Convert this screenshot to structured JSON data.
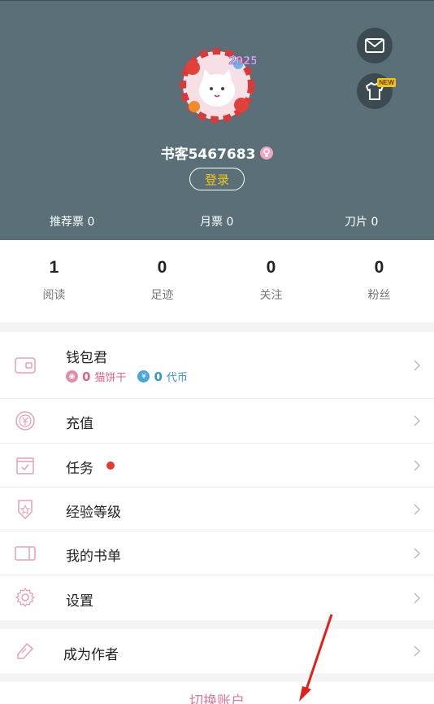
{
  "profile": {
    "username": "书客5467683",
    "login_label": "登录",
    "avatar_badge": "2025"
  },
  "header_icons": {
    "mail": "mail-icon",
    "dress": "tshirt-icon",
    "new_badge": "NEW"
  },
  "tickets": [
    {
      "label": "推荐票 0"
    },
    {
      "label": "月票 0"
    },
    {
      "label": "刀片 0"
    }
  ],
  "stats": [
    {
      "value": "1",
      "label": "阅读"
    },
    {
      "value": "0",
      "label": "足迹"
    },
    {
      "value": "0",
      "label": "关注"
    },
    {
      "value": "0",
      "label": "粉丝"
    }
  ],
  "wallet": {
    "label": "钱包君",
    "cat_value": "0",
    "cat_label": "猫饼干",
    "token_value": "0",
    "token_label": "代币"
  },
  "menu": [
    {
      "label": "充值",
      "icon": "yuan-icon"
    },
    {
      "label": "任务",
      "icon": "task-icon",
      "dot": true
    },
    {
      "label": "经验等级",
      "icon": "level-icon"
    },
    {
      "label": "我的书单",
      "icon": "booklist-icon"
    },
    {
      "label": "设置",
      "icon": "gear-icon"
    }
  ],
  "author": {
    "label": "成为作者"
  },
  "switch_account": "切换账户",
  "colors": {
    "header_bg": "#5b6f78",
    "icon_pink": "#e3a2b7",
    "accent_yellow": "#f5c518",
    "annotation_red": "#e0201b"
  }
}
